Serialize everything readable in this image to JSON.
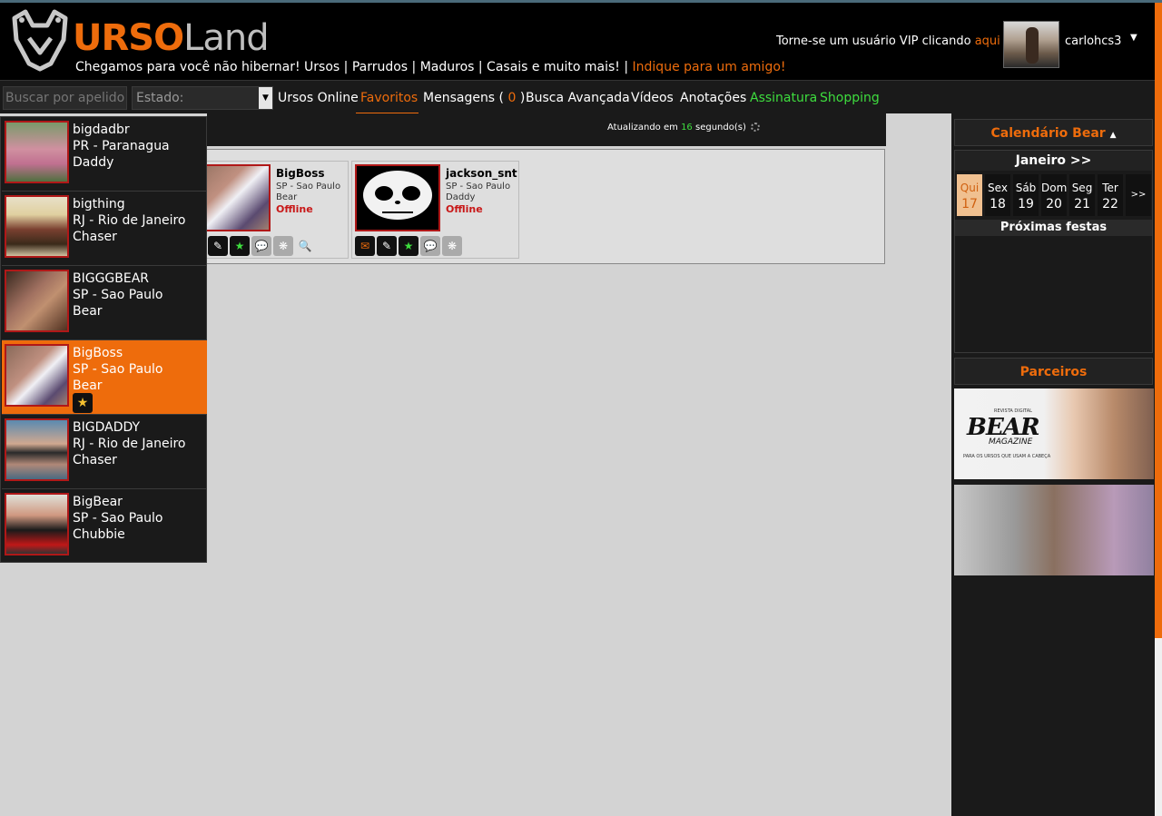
{
  "header": {
    "logo_urso": "URSO",
    "logo_land": "Land",
    "tagline": "Chegamos para você não hibernar! Ursos | Parrudos | Maduros | Casais e muito mais! |",
    "tagline_link": "Indique para um amigo!",
    "vip_text": "Torne-se um usuário VIP clicando",
    "vip_link": "aqui",
    "username": "carlohcs3"
  },
  "nav": {
    "search_placeholder": "Buscar por apelido",
    "estado_label": "Estado:",
    "items": [
      "Ursos Online",
      "Favoritos",
      "Mensagens (",
      "0",
      ")",
      "Busca Avançada",
      "Vídeos",
      "Anotações",
      "Assinatura",
      "Shopping"
    ]
  },
  "main": {
    "updating_prefix": "Atualizando em",
    "updating_seconds": "16",
    "updating_suffix": "segundo(s)",
    "cards": [
      {
        "name": "BigBoss",
        "location": "SP - Sao Paulo",
        "type": "Bear",
        "status": "Offline"
      },
      {
        "name": "jackson_snt",
        "location": "SP - Sao Paulo",
        "type": "Daddy",
        "status": "Offline"
      }
    ]
  },
  "dropdown": [
    {
      "name": "bigdadbr",
      "location": "PR - Paranagua",
      "type": "Daddy"
    },
    {
      "name": "bigthing",
      "location": "RJ - Rio de Janeiro",
      "type": "Chaser"
    },
    {
      "name": "BIGGGBEAR",
      "location": "SP - Sao Paulo",
      "type": "Bear"
    },
    {
      "name": "BigBoss",
      "location": "SP - Sao Paulo",
      "type": "Bear"
    },
    {
      "name": "BIGDADDY",
      "location": "RJ - Rio de Janeiro",
      "type": "Chaser"
    },
    {
      "name": "BigBear",
      "location": "SP - Sao Paulo",
      "type": "Chubbie"
    }
  ],
  "sidebar": {
    "calendar_title": "Calendário Bear",
    "month": "Janeiro >>",
    "days": [
      {
        "name": "Qui",
        "num": "17"
      },
      {
        "name": "Sex",
        "num": "18"
      },
      {
        "name": "Sáb",
        "num": "19"
      },
      {
        "name": "Dom",
        "num": "20"
      },
      {
        "name": "Seg",
        "num": "21"
      },
      {
        "name": "Ter",
        "num": "22"
      }
    ],
    "next_label": ">>",
    "next_parties": "Próximas festas",
    "partners_title": "Parceiros",
    "bear_logo": "BEAR",
    "bear_sub": "MAGAZINE",
    "bear_top": "REVISTA DIGITAL",
    "bear_tag": "PARA OS URSOS QUE USAM A CABEÇA"
  }
}
